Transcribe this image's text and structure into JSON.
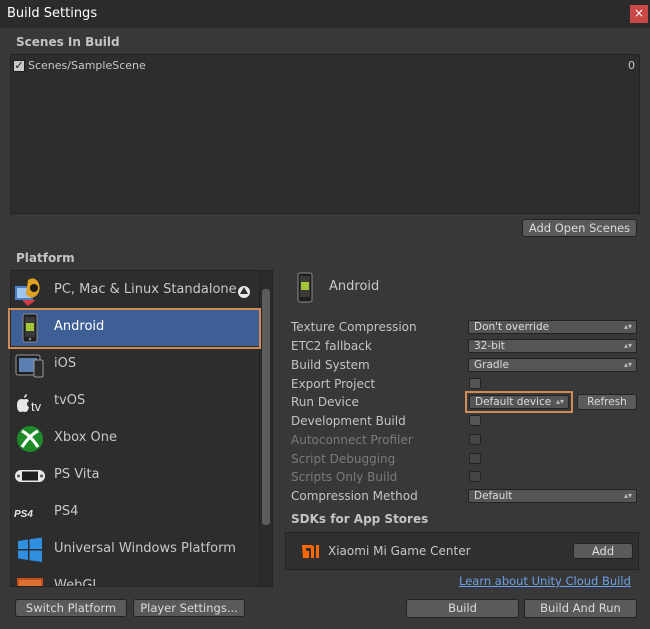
{
  "window": {
    "title": "Build Settings",
    "close_label": "×"
  },
  "scenes": {
    "header": "Scenes In Build",
    "items": [
      {
        "name": "Scenes/SampleScene",
        "index": "0",
        "checked": true
      }
    ],
    "add_open_scenes_label": "Add Open Scenes"
  },
  "platform": {
    "header": "Platform",
    "items": [
      {
        "label": "PC, Mac & Linux Standalone",
        "icon": "pc-mac-linux-icon"
      },
      {
        "label": "Android",
        "icon": "android-phone-icon",
        "selected": true
      },
      {
        "label": "iOS",
        "icon": "ios-device-icon"
      },
      {
        "label": "tvOS",
        "icon": "apple-tv-icon"
      },
      {
        "label": "Xbox One",
        "icon": "xbox-icon"
      },
      {
        "label": "PS Vita",
        "icon": "ps-vita-icon"
      },
      {
        "label": "PS4",
        "icon": "ps4-icon"
      },
      {
        "label": "Universal Windows Platform",
        "icon": "windows-icon"
      },
      {
        "label": "WebGL",
        "icon": "webgl-icon"
      }
    ]
  },
  "settings": {
    "title": "Android",
    "texture_compression": {
      "label": "Texture Compression",
      "value": "Don't override"
    },
    "etc2_fallback": {
      "label": "ETC2 fallback",
      "value": "32-bit"
    },
    "build_system": {
      "label": "Build System",
      "value": "Gradle"
    },
    "export_project": {
      "label": "Export Project"
    },
    "run_device": {
      "label": "Run Device",
      "value": "Default device",
      "refresh_label": "Refresh"
    },
    "development_build": {
      "label": "Development Build"
    },
    "autoconnect_profiler": {
      "label": "Autoconnect Profiler"
    },
    "script_debugging": {
      "label": "Script Debugging"
    },
    "scripts_only_build": {
      "label": "Scripts Only Build"
    },
    "compression_method": {
      "label": "Compression Method",
      "value": "Default"
    }
  },
  "sdks": {
    "header": "SDKs for App Stores",
    "items": [
      {
        "name": "Xiaomi Mi Game Center",
        "icon": "xiaomi-mi-icon",
        "button": "Add"
      }
    ],
    "cloud_link": "Learn about Unity Cloud Build"
  },
  "footer": {
    "switch_platform": "Switch Platform",
    "player_settings": "Player Settings...",
    "build": "Build",
    "build_and_run": "Build And Run"
  },
  "colors": {
    "selection": "#3e5f96",
    "highlight_border": "#d08a55",
    "link": "#6d9fe6",
    "close_button": "#c94848"
  }
}
